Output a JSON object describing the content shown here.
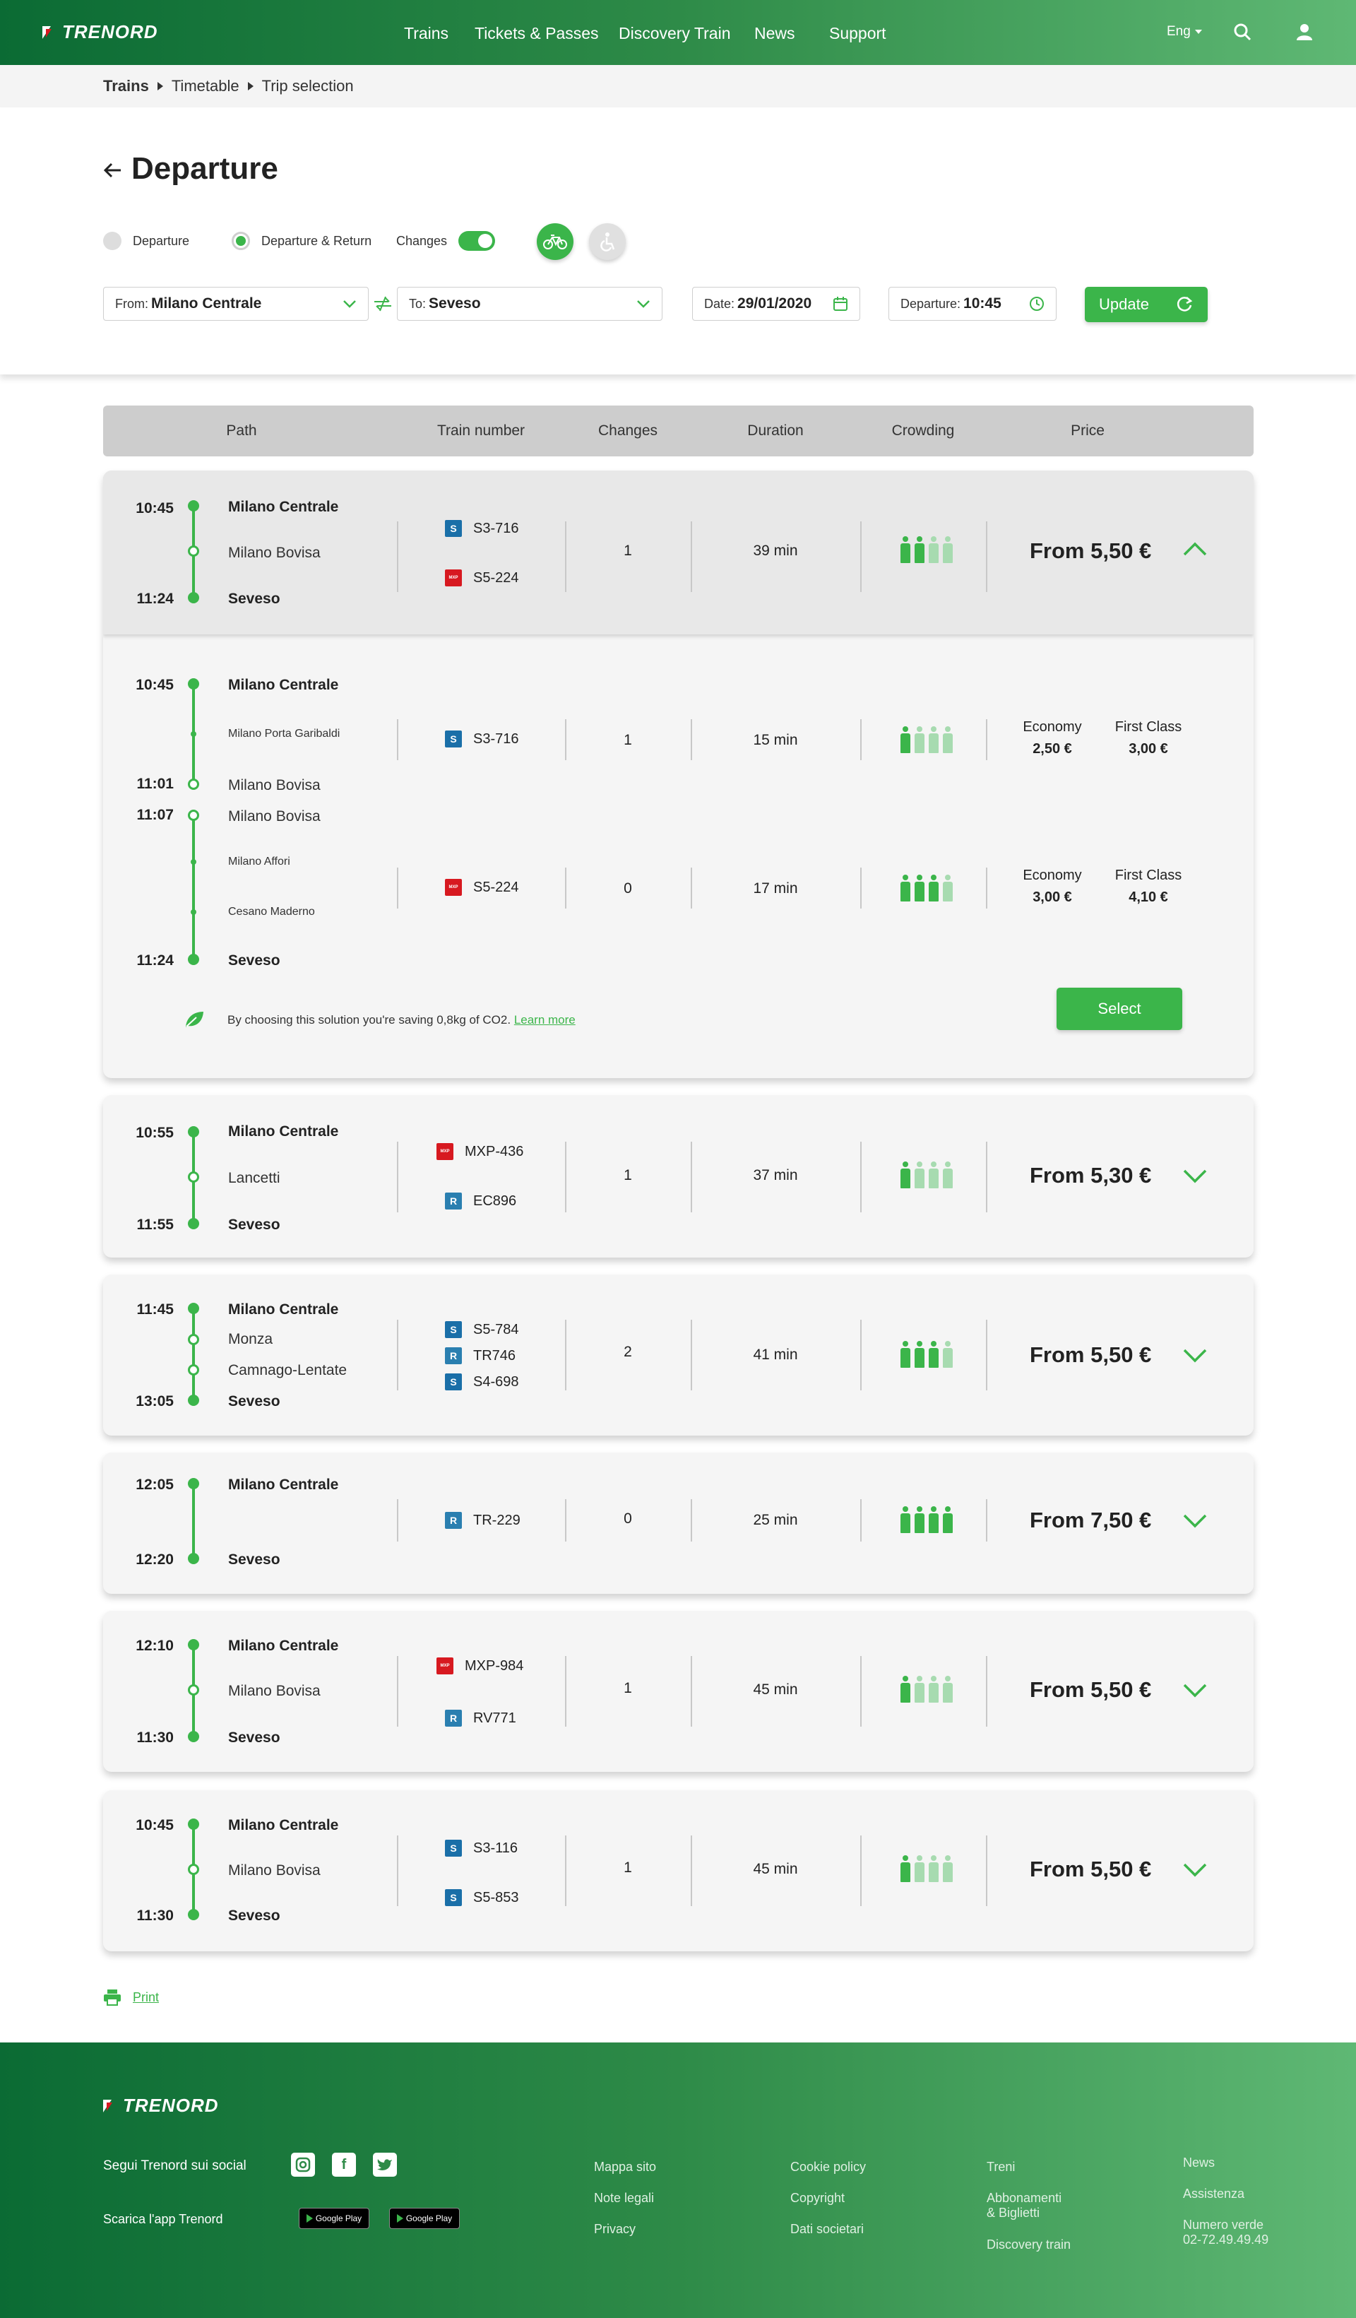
{
  "header": {
    "logo": "TRENORD",
    "nav": [
      "Trains",
      "Tickets & Passes",
      "Discovery Train",
      "News",
      "Support"
    ],
    "lang": "Eng"
  },
  "breadcrumb": [
    "Trains",
    "Timetable",
    "Trip selection"
  ],
  "search": {
    "title": "Departure",
    "opt_departure": "Departure",
    "opt_return": "Departure & Return",
    "changes_label": "Changes",
    "from_label": "From:",
    "from_value": "Milano Centrale",
    "to_label": "To:",
    "to_value": "Seveso",
    "date_label": "Date:",
    "date_value": "29/01/2020",
    "time_label": "Departure:",
    "time_value": "10:45",
    "update_label": "Update"
  },
  "table_head": {
    "path": "Path",
    "train": "Train number",
    "changes": "Changes",
    "duration": "Duration",
    "crowding": "Crowding",
    "price": "Price"
  },
  "solutions": [
    {
      "dep": "10:45",
      "arr": "11:24",
      "from": "Milano Centrale",
      "via": [
        "Milano Bovisa"
      ],
      "to": "Seveso",
      "trains": [
        {
          "brand": "S",
          "code": "S3-716"
        },
        {
          "brand": "M",
          "code": "S5-224"
        }
      ],
      "changes": "1",
      "duration": "39 min",
      "crowding": 2,
      "price": "From 5,50 €",
      "expanded": true
    },
    {
      "dep": "10:55",
      "arr": "11:55",
      "from": "Milano Centrale",
      "via": [
        "Lancetti"
      ],
      "to": "Seveso",
      "trains": [
        {
          "brand": "M",
          "code": "MXP-436"
        },
        {
          "brand": "T",
          "code": "EC896"
        }
      ],
      "changes": "1",
      "duration": "37 min",
      "crowding": 1,
      "price": "From 5,30 €"
    },
    {
      "dep": "11:45",
      "arr": "13:05",
      "from": "Milano Centrale",
      "via": [
        "Monza",
        "Camnago-Lentate"
      ],
      "to": "Seveso",
      "trains": [
        {
          "brand": "S",
          "code": "S5-784"
        },
        {
          "brand": "T",
          "code": "TR746"
        },
        {
          "brand": "S",
          "code": "S4-698"
        }
      ],
      "changes": "2",
      "duration": "41 min",
      "crowding": 3,
      "price": "From 5,50 €"
    },
    {
      "dep": "12:05",
      "arr": "12:20",
      "from": "Milano Centrale",
      "via": [],
      "to": "Seveso",
      "trains": [
        {
          "brand": "T",
          "code": "TR-229"
        }
      ],
      "changes": "0",
      "duration": "25 min",
      "crowding": 4,
      "price": "From 7,50 €"
    },
    {
      "dep": "12:10",
      "arr": "11:30",
      "from": "Milano Centrale",
      "via": [
        "Milano Bovisa"
      ],
      "to": "Seveso",
      "trains": [
        {
          "brand": "M",
          "code": "MXP-984"
        },
        {
          "brand": "T",
          "code": "RV771"
        }
      ],
      "changes": "1",
      "duration": "45 min",
      "crowding": 1,
      "price": "From 5,50 €"
    },
    {
      "dep": "10:45",
      "arr": "11:30",
      "from": "Milano Centrale",
      "via": [
        "Milano Bovisa"
      ],
      "to": "Seveso",
      "trains": [
        {
          "brand": "S",
          "code": "S3-116"
        },
        {
          "brand": "S",
          "code": "S5-853"
        }
      ],
      "changes": "1",
      "duration": "45 min",
      "crowding": 1,
      "price": "From 5,50 €"
    }
  ],
  "detail": {
    "leg1": {
      "dep": "10:45",
      "arr": "11:01",
      "from": "Milano Centrale",
      "stop": "Milano Porta Garibaldi",
      "to": "Milano Bovisa",
      "code": "S3-716",
      "changes": "1",
      "duration": "15 min",
      "crowding": 1,
      "econ_label": "Economy",
      "econ": "2,50 €",
      "first_label": "First Class",
      "first": "3,00 €"
    },
    "leg2": {
      "dep": "11:07",
      "arr": "11:24",
      "from": "Milano Bovisa",
      "stop1": "Milano Affori",
      "stop2": "Cesano Maderno",
      "to": "Seveso",
      "code": "S5-224",
      "changes": "0",
      "duration": "17 min",
      "crowding": 3,
      "econ_label": "Economy",
      "econ": "3,00 €",
      "first_label": "First Class",
      "first": "4,10 €"
    },
    "co2_text": "By choosing this solution you're saving 0,8kg of CO2.",
    "learn_more": "Learn more",
    "select_label": "Select"
  },
  "print_label": "Print",
  "footer": {
    "logo": "TRENORD",
    "social_label": "Segui Trenord sui social",
    "app_label": "Scarica l'app Trenord",
    "store_label": "Google Play",
    "col1": [
      "Mappa sito",
      "Note legali",
      "Privacy"
    ],
    "col2": [
      "Cookie policy",
      "Copyright",
      "Dati societari"
    ],
    "col3": [
      "Treni",
      "Abbonamenti",
      "& Biglietti",
      "Discovery train"
    ],
    "col4": [
      "News",
      "Assistenza",
      "Numero verde",
      "02-72.49.49.49"
    ]
  },
  "colors": {
    "brand_green": "#3bb54a",
    "header_dark": "#0b6b34",
    "header_light": "#5fb874",
    "crowd_light": "#a7dbb0"
  }
}
